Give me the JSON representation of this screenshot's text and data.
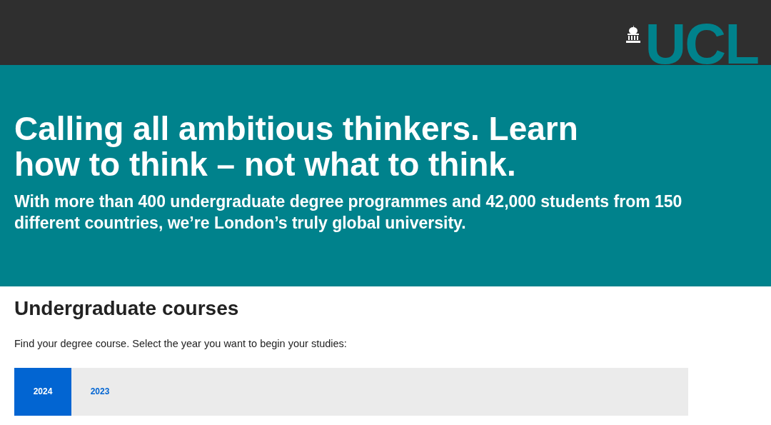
{
  "header": {
    "logo": "UCL"
  },
  "hero": {
    "headline": "Calling all ambitious thinkers. Learn how to think – not what to think.",
    "subtext": "With more than 400 undergraduate degree programmes and 42,000 students from 150 different countries, we’re London’s truly global university."
  },
  "courses": {
    "title": "Undergraduate courses",
    "intro": "Find your degree course. Select the year you want to begin your studies:",
    "tabs": [
      {
        "label": "2024",
        "selected": true
      },
      {
        "label": "2023",
        "selected": false
      }
    ]
  }
}
